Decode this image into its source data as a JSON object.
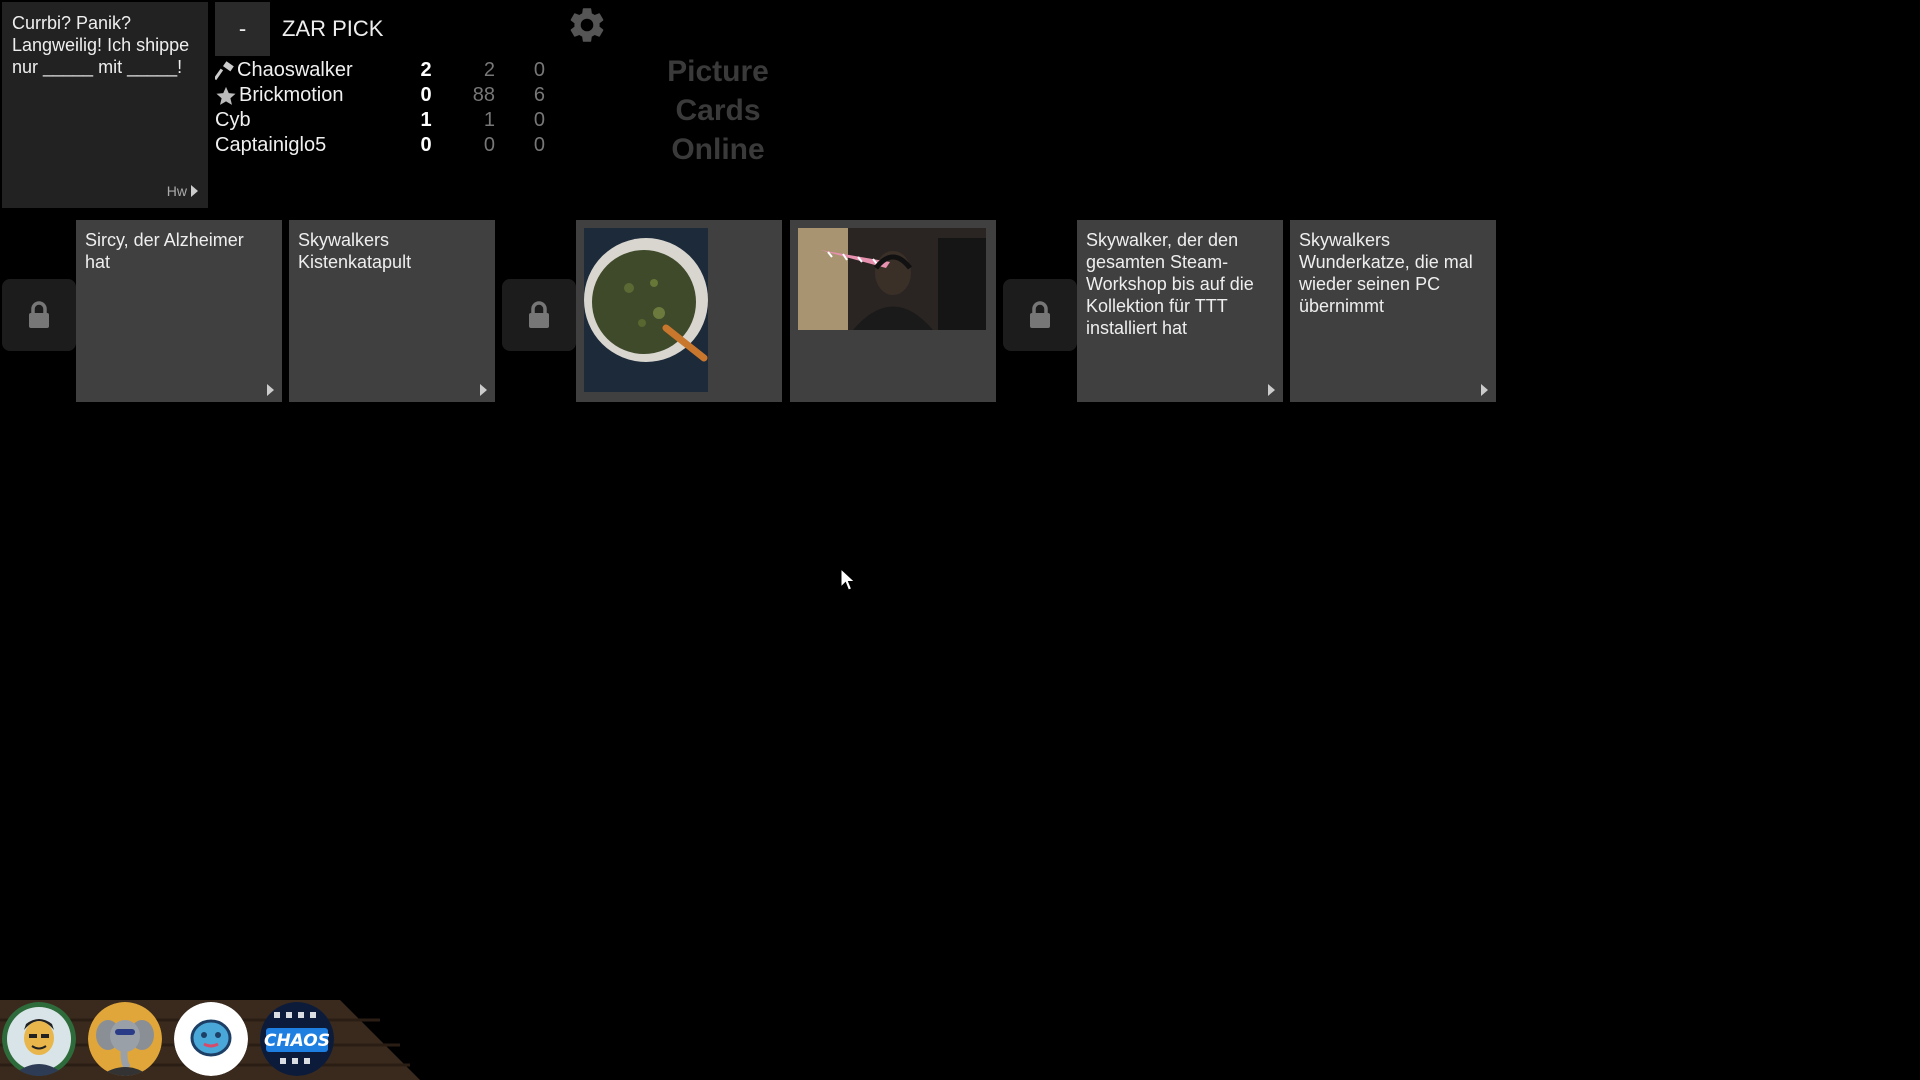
{
  "black_card": {
    "text": "Currbi? Panik?\nLangweilig! Ich shippe\nnur _____ mit _____!",
    "pack": "Hw"
  },
  "header": {
    "minus_label": "-",
    "phase": "ZAR PICK",
    "settings_icon": "gear-icon"
  },
  "scoreboard": {
    "players": [
      {
        "name": "Chaoswalker",
        "icon": "hammer-icon",
        "points": "2",
        "col2": "2",
        "col3": "0"
      },
      {
        "name": "Brickmotion",
        "icon": "star-icon",
        "points": "0",
        "col2": "88",
        "col3": "6"
      },
      {
        "name": "Cyb",
        "icon": "",
        "points": "1",
        "col2": "1",
        "col3": "0"
      },
      {
        "name": "Captainiglo5",
        "icon": "",
        "points": "0",
        "col2": "0",
        "col3": "0"
      }
    ]
  },
  "logo": {
    "line1": "Picture",
    "line2": "Cards",
    "line3": "Online"
  },
  "submissions": [
    {
      "lock_icon": "lock-icon",
      "cards": [
        {
          "type": "text",
          "text": "Sircy, der Alzheimer hat"
        },
        {
          "type": "text",
          "text": "Skywalkers Kistenkatapult"
        }
      ]
    },
    {
      "lock_icon": "lock-icon",
      "cards": [
        {
          "type": "image",
          "image": "soup-bowl-photo"
        },
        {
          "type": "image",
          "image": "person-with-unicorn-horn-photo"
        }
      ]
    },
    {
      "lock_icon": "lock-icon",
      "cards": [
        {
          "type": "text",
          "text": "Skywalker, der den gesamten Steam-Workshop bis auf die Kollektion für TTT installiert hat"
        },
        {
          "type": "text",
          "text": "Skywalkers Wunderkatze, die mal wieder seinen PC übernimmt"
        }
      ]
    }
  ],
  "colors": {
    "background": "#000000",
    "card_white": "#404040",
    "card_black": "#222222",
    "logo": "#3a3a3a"
  },
  "avatars": [
    {
      "name": "avatar-cartoon-man"
    },
    {
      "name": "avatar-elephant"
    },
    {
      "name": "avatar-blue-robot"
    },
    {
      "name": "avatar-chaos-logo"
    }
  ]
}
